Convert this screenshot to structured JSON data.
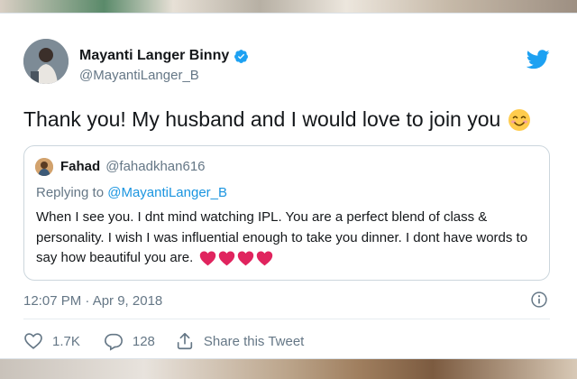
{
  "colors": {
    "accent": "#1da1f2",
    "link": "#1b95e0",
    "text": "#14171a",
    "secondary_text": "#657786",
    "heart": "#e0245e",
    "border": "#ccd6dd"
  },
  "tweet": {
    "author": {
      "display_name": "Mayanti Langer Binny",
      "handle": "@MayantiLanger_B",
      "verified": true
    },
    "text": "Thank you! My husband and I would love to join you",
    "text_emoji_icon": "smiling-face-icon",
    "timestamp": "12:07 PM · Apr 9, 2018"
  },
  "quoted_tweet": {
    "author": {
      "display_name": "Fahad",
      "handle": "@fahadkhan616"
    },
    "reply_prefix": "Replying to",
    "reply_handle": "@MayantiLanger_B",
    "text": "When I see you. I dnt mind watching IPL. You are a perfect blend of class & personality. I wish I was influential enough to take you dinner. I dont have words to say how beautiful you are.",
    "emoji_icons": [
      "red-heart-icon",
      "red-heart-icon",
      "red-heart-icon",
      "red-heart-icon"
    ]
  },
  "actions": {
    "like_count": "1.7K",
    "reply_count": "128",
    "share_label": "Share this Tweet"
  }
}
